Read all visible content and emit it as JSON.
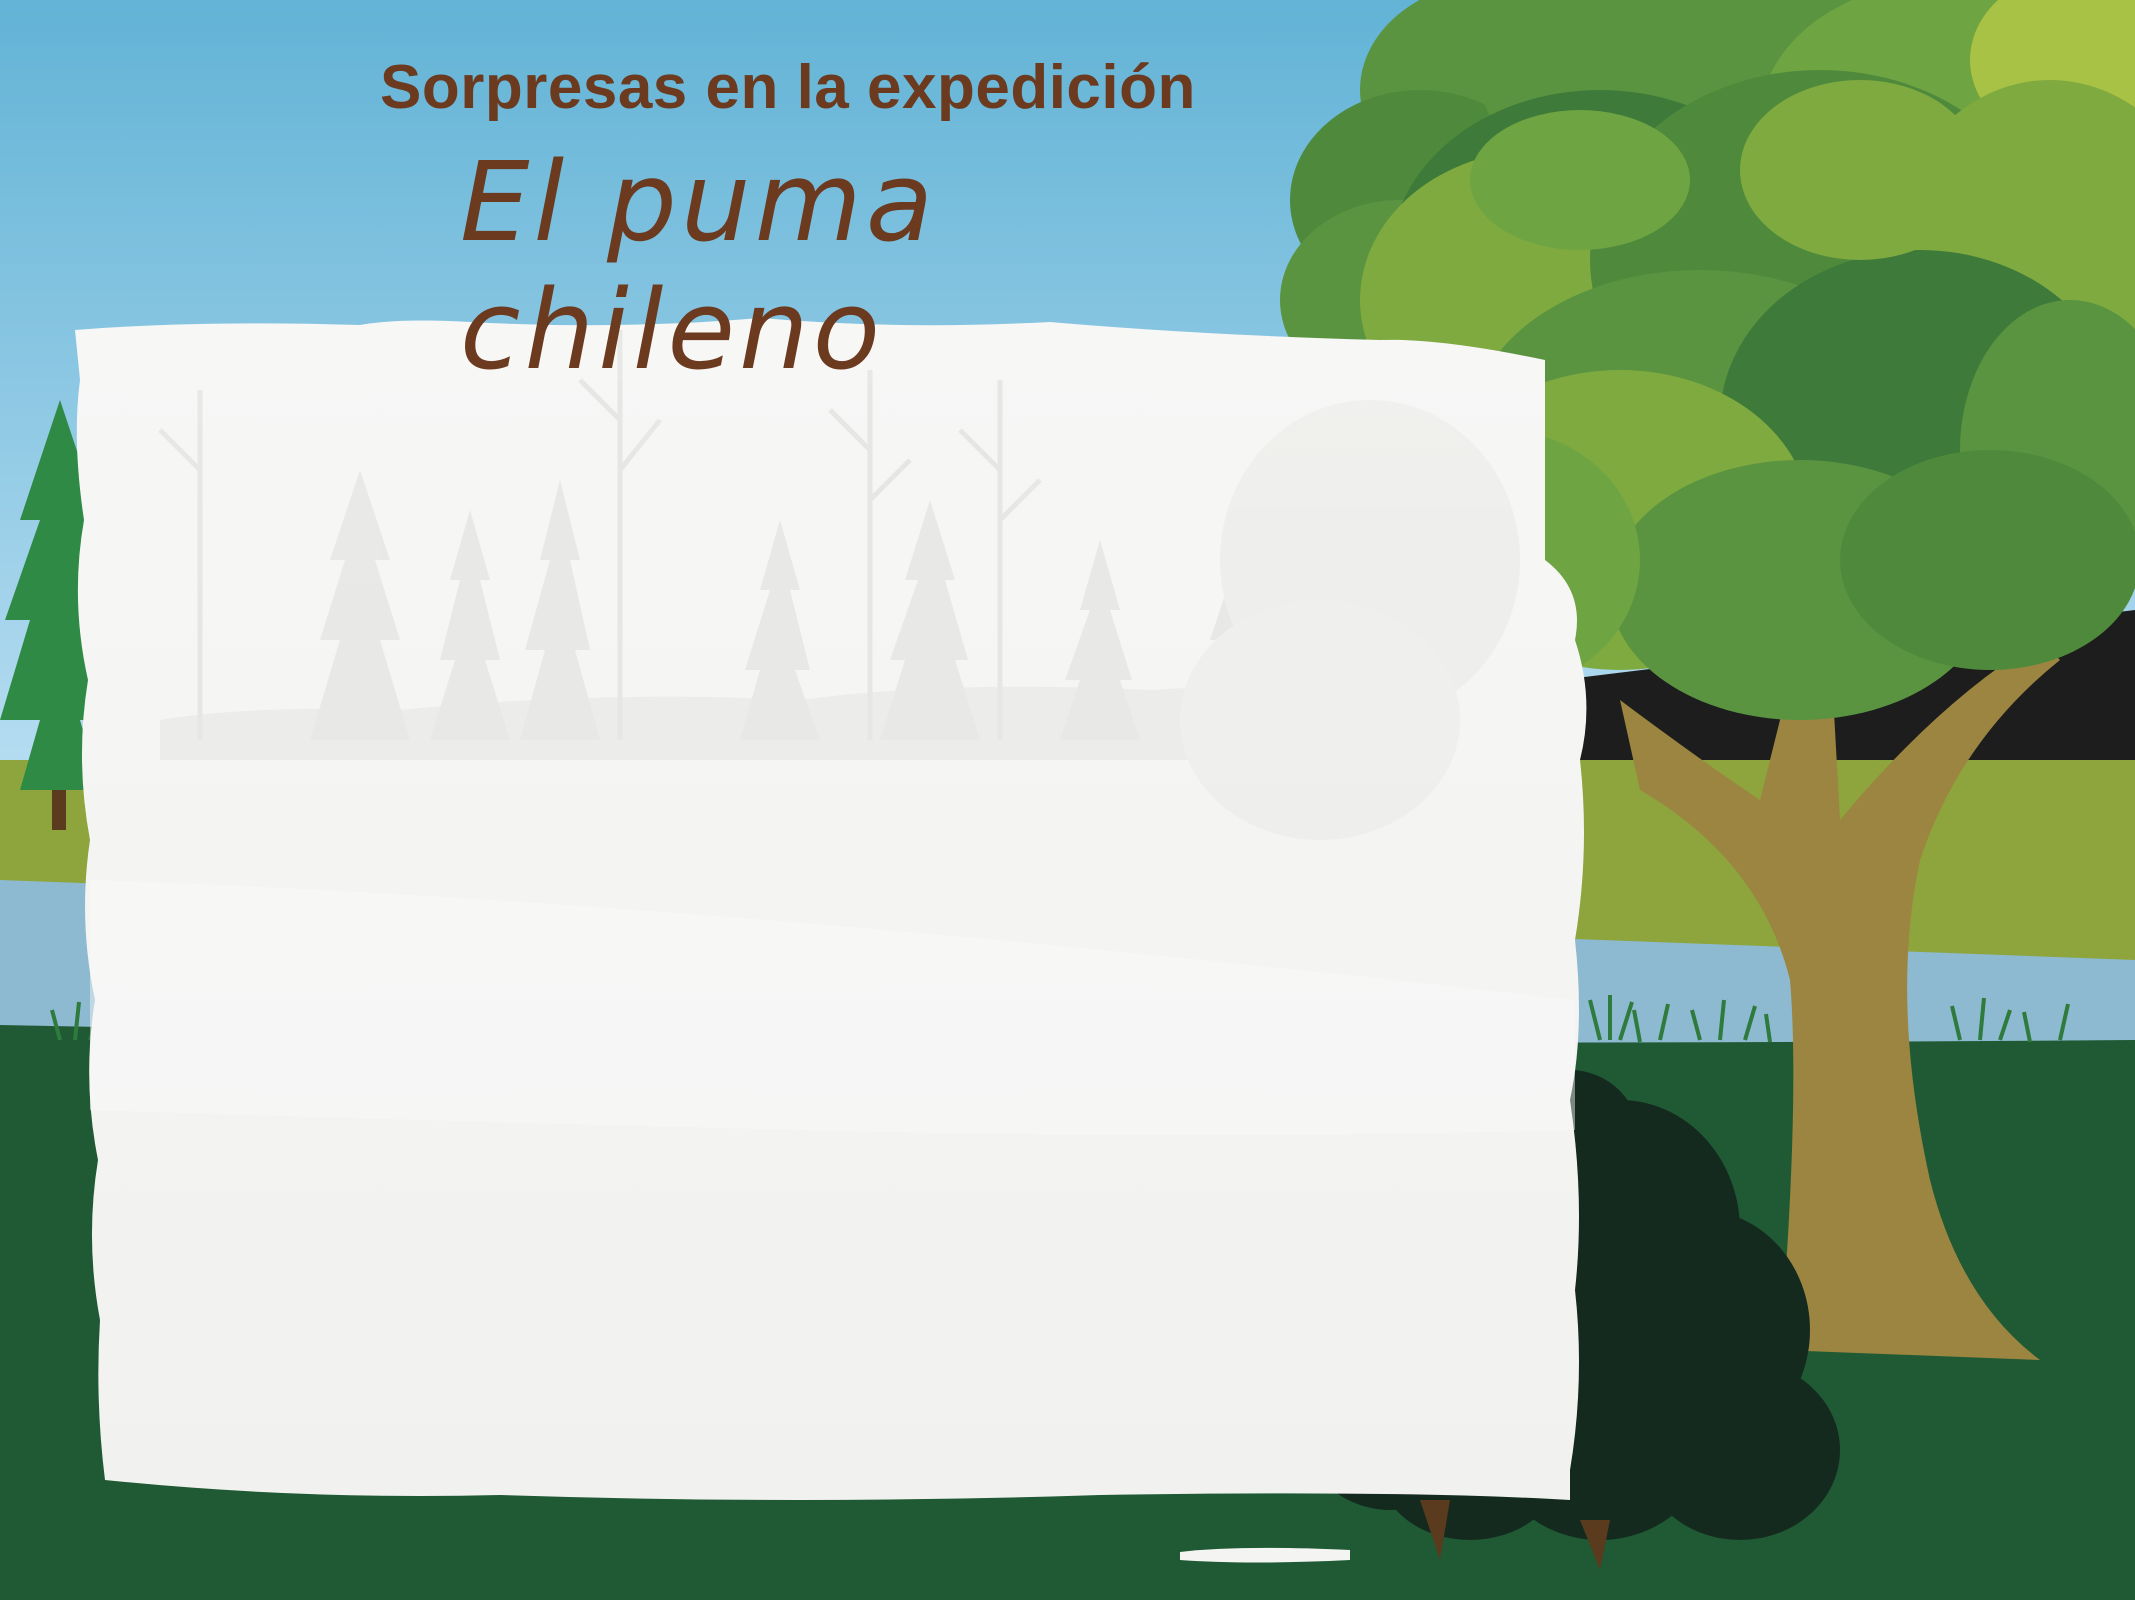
{
  "header": {
    "subtitle": "Sorpresas en la expedición",
    "title": "El puma chileno"
  },
  "colors": {
    "sky_top": "#62b3d6",
    "sky_bottom": "#b9def2",
    "meadow": "#8da53c",
    "river": "#8dbad0",
    "grass": "#1f5a34",
    "title_brown": "#6b3a1f",
    "tree_trunk": "#9b8540",
    "foliage_light": "#7faa40",
    "foliage_mid": "#5a9440",
    "foliage_dark": "#3e7a3a",
    "bush": "#152a1f",
    "panel": "#f4f4f2"
  },
  "icons": [
    "paw-print-icon"
  ]
}
